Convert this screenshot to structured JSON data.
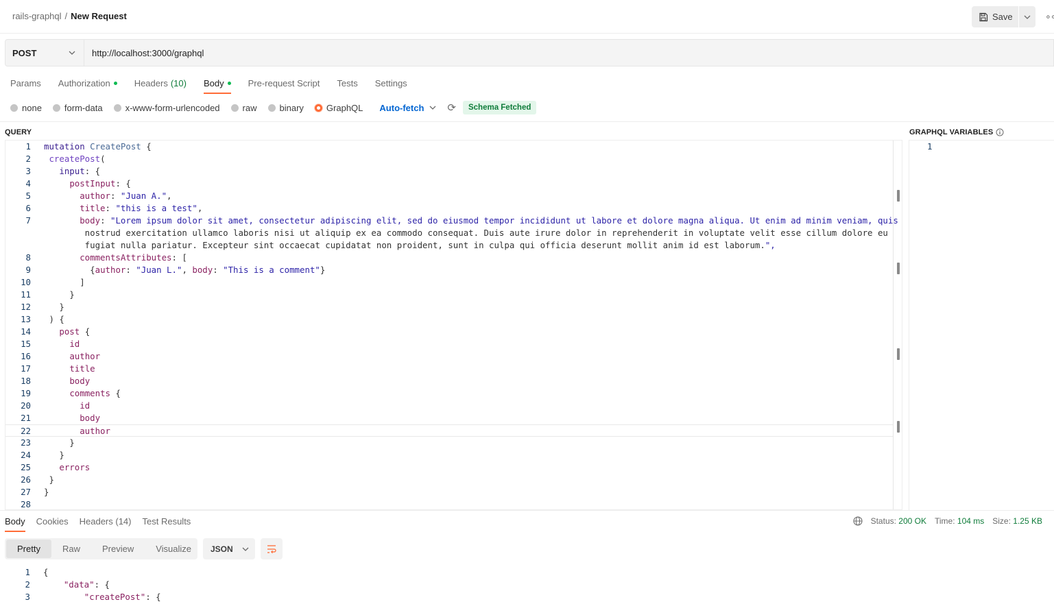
{
  "breadcrumb": {
    "parent": "rails-graphql",
    "separator": "/",
    "current": "New Request"
  },
  "toolbar": {
    "save_label": "Save"
  },
  "request": {
    "method": "POST",
    "url": "http://localhost:3000/graphql"
  },
  "request_tabs": [
    {
      "label": "Params"
    },
    {
      "label": "Authorization",
      "dot": true
    },
    {
      "label": "Headers",
      "count": "(10)"
    },
    {
      "label": "Body",
      "dot": true,
      "active": true
    },
    {
      "label": "Pre-request Script"
    },
    {
      "label": "Tests"
    },
    {
      "label": "Settings"
    }
  ],
  "body_types": [
    "none",
    "form-data",
    "x-www-form-urlencoded",
    "raw",
    "binary",
    "GraphQL"
  ],
  "body_type_selected": "GraphQL",
  "autofetch_label": "Auto-fetch",
  "schema_badge": "Schema Fetched",
  "query_label": "QUERY",
  "variables_label": "GRAPHQL VARIABLES",
  "variables_line": "1",
  "query_lines": [
    {
      "n": "1",
      "text": "mutation CreatePost {"
    },
    {
      "n": "2",
      "text": " createPost("
    },
    {
      "n": "3",
      "text": "   input: {"
    },
    {
      "n": "4",
      "text": "     postInput: {"
    },
    {
      "n": "5",
      "text": "       author: \"Juan A.\","
    },
    {
      "n": "6",
      "text": "       title: \"this is a test\","
    },
    {
      "n": "7",
      "text": "       body: \"Lorem ipsum dolor sit amet, consectetur adipiscing elit, sed do eiusmod tempor incididunt ut labore et dolore magna aliqua. Ut enim ad minim veniam, quis"
    },
    {
      "n": "",
      "text": "        nostrud exercitation ullamco laboris nisi ut aliquip ex ea commodo consequat. Duis aute irure dolor in reprehenderit in voluptate velit esse cillum dolore eu"
    },
    {
      "n": "",
      "text": "        fugiat nulla pariatur. Excepteur sint occaecat cupidatat non proident, sunt in culpa qui officia deserunt mollit anim id est laborum.\","
    },
    {
      "n": "8",
      "text": "       commentsAttributes: ["
    },
    {
      "n": "9",
      "text": "         {author: \"Juan L.\", body: \"This is a comment\"}"
    },
    {
      "n": "10",
      "text": "       ]"
    },
    {
      "n": "11",
      "text": "     }"
    },
    {
      "n": "12",
      "text": "   }"
    },
    {
      "n": "13",
      "text": " ) {"
    },
    {
      "n": "14",
      "text": "   post {"
    },
    {
      "n": "15",
      "text": "     id"
    },
    {
      "n": "16",
      "text": "     author"
    },
    {
      "n": "17",
      "text": "     title"
    },
    {
      "n": "18",
      "text": "     body"
    },
    {
      "n": "19",
      "text": "     comments {"
    },
    {
      "n": "20",
      "text": "       id"
    },
    {
      "n": "21",
      "text": "       body"
    },
    {
      "n": "22",
      "text": "       author"
    },
    {
      "n": "23",
      "text": "     }"
    },
    {
      "n": "24",
      "text": "   }"
    },
    {
      "n": "25",
      "text": "   errors"
    },
    {
      "n": "26",
      "text": " }"
    },
    {
      "n": "27",
      "text": "}"
    },
    {
      "n": "28",
      "text": ""
    }
  ],
  "response_tabs": [
    {
      "label": "Body",
      "active": true
    },
    {
      "label": "Cookies"
    },
    {
      "label": "Headers",
      "count": "(14)"
    },
    {
      "label": "Test Results"
    }
  ],
  "response_meta": {
    "status_label": "Status:",
    "status": "200 OK",
    "time_label": "Time:",
    "time": "104 ms",
    "size_label": "Size:",
    "size": "1.25 KB"
  },
  "view_modes": [
    "Pretty",
    "Raw",
    "Preview",
    "Visualize"
  ],
  "view_mode_selected": "Pretty",
  "format": "JSON",
  "response_lines": [
    {
      "n": "1",
      "text": "{"
    },
    {
      "n": "2",
      "text": "    \"data\": {"
    },
    {
      "n": "3",
      "text": "        \"createPost\": {"
    }
  ],
  "colors": {
    "accent": "#ff6c37",
    "success": "#0f7c3a",
    "link": "#0265d2"
  }
}
